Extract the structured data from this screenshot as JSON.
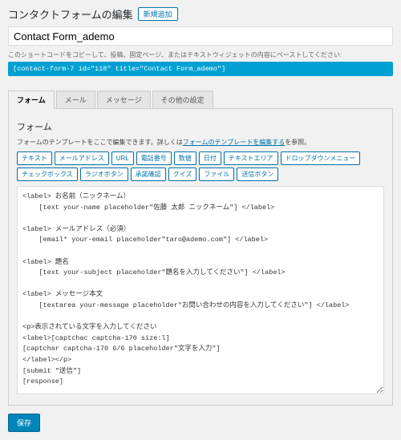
{
  "header": {
    "title": "コンタクトフォームの編集",
    "add_new": "新規追加"
  },
  "title_field": {
    "value": "Contact Form_ademo"
  },
  "shortcode": {
    "hint": "このショートコードをコピーして、投稿、固定ページ、またはテキストウィジェットの内容にペーストしてください:",
    "code": "[contact-form-7 id=\"118\" title=\"Contact Form_ademo\"]"
  },
  "tabs": {
    "form": "フォーム",
    "mail": "メール",
    "messages": "メッセージ",
    "other": "その他の設定"
  },
  "form_panel": {
    "heading": "フォーム",
    "desc_prefix": "フォームのテンプレートをここで編集できます。詳しくは",
    "desc_link": "フォームのテンプレートを編集する",
    "desc_suffix": "を参照。",
    "tags": {
      "text": "テキスト",
      "email": "メールアドレス",
      "url": "URL",
      "tel": "電話番号",
      "number": "数値",
      "date": "日付",
      "textarea": "テキストエリア",
      "dropdown": "ドロップダウンメニュー",
      "checkbox": "チェックボックス",
      "radio": "ラジオボタン",
      "acceptance": "承諾確認",
      "quiz": "クイズ",
      "file": "ファイル",
      "submit": "送信ボタン"
    },
    "template": "<label> お名前（ニックネーム）\n    [text your-name placeholder\"佐藤 太郎 ニックネーム\"] </label>\n\n<label> メールアドレス（必須）\n    [email* your-email placeholder\"taro@ademo.com\"] </label>\n\n<label> 題名\n    [text your-subject placeholder\"題名を入力してください\"] </label>\n\n<label> メッセージ本文\n    [textarea your-message placeholder\"お問い合わせの内容を入力してください\"] </label>\n\n<p>表示されている文字を入力してください\n<label>[captchac captcha-170 size:l]\n[captchar captcha-170 6/6 placeholder\"文字を入力\"]\n</label></p>\n[submit \"送信\"]\n[response]"
  },
  "actions": {
    "save": "保存"
  }
}
